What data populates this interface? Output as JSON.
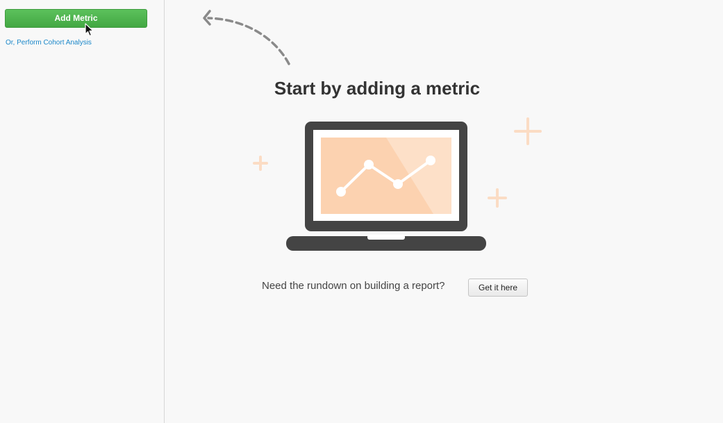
{
  "sidebar": {
    "add_metric_label": "Add Metric",
    "cohort_link_label": "Or, Perform Cohort Analysis"
  },
  "main": {
    "headline": "Start by adding a metric",
    "rundown_text": "Need the rundown on building a report?",
    "get_it_label": "Get it here"
  },
  "icons": {
    "arrow": "dashed-curved-arrow-icon",
    "illustration": "laptop-chart-illustration",
    "cursor": "mouse-pointer-icon"
  },
  "colors": {
    "primary_button": "#4cb34c",
    "link": "#1a87c9",
    "laptop": "#444444",
    "chart_fill": "#fcd2b0",
    "plus_accent": "#fbdcc4"
  }
}
